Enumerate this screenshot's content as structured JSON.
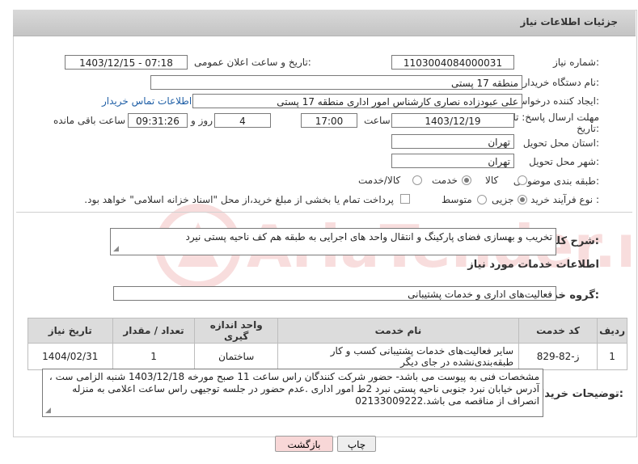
{
  "header": {
    "title": "جزئیات اطلاعات نیاز"
  },
  "fields": {
    "need_number_label": "شماره نیاز:",
    "need_number": "1103004084000031",
    "announce_label": "تاریخ و ساعت اعلان عمومی:",
    "announce_value": "1403/12/15 - 07:18",
    "buyer_label": "نام دستگاه خریدار:",
    "buyer_value": "منطقه 17 پستی",
    "creator_label": "ایجاد کننده درخواست:",
    "creator_value": "علی عبودزاده نصاری کارشناس امور اداری منطقه 17 پستی",
    "contact_link": "اطلاعات تماس خریدار",
    "deadline_label_1": "مهلت ارسال پاسخ: تا",
    "deadline_label_2": "تاریخ:",
    "deadline_date": "1403/12/19",
    "time_label": "ساعت",
    "deadline_time": "17:00",
    "days_value": "4",
    "days_label": "روز و",
    "remaining_time": "09:31:26",
    "remaining_label": "ساعت باقی مانده",
    "province_label": "استان محل تحویل:",
    "province_value": "تهران",
    "city_label": "شهر محل تحویل:",
    "city_value": "تهران",
    "category_label": "طبقه بندی موضوعی:",
    "category_options": [
      "کالا",
      "خدمت",
      "کالا/خدمت"
    ],
    "category_selected": "خدمت",
    "process_label": "نوع فرآیند خرید :",
    "process_options": [
      "جزیی",
      "متوسط"
    ],
    "process_selected": "جزیی",
    "payment_note": "پرداخت تمام یا بخشی از مبلغ خرید،از محل \"اسناد خزانه اسلامی\" خواهد بود."
  },
  "description": {
    "label": "شرح کلی نیاز:",
    "value": "تخریب و بهسازی فضای پارکینگ و انتقال واحد های اجرایی به طبقه هم کف ناحیه پستی نیرد"
  },
  "services": {
    "section_title": "اطلاعات خدمات مورد نیاز",
    "group_label": "گروه خدمت:",
    "group_value": "فعالیت‌های اداری و خدمات پشتیبانی",
    "columns": [
      "ردیف",
      "کد خدمت",
      "نام خدمت",
      "واحد اندازه گیری",
      "تعداد / مقدار",
      "تاریخ نیاز"
    ],
    "rows": [
      {
        "row": "1",
        "code": "ز-82-829",
        "name": "سایر فعالیت‌های خدمات پشتیبانی کسب و کار طبقه‌بندی‌نشده در جای دیگر",
        "unit": "ساختمان",
        "qty": "1",
        "date": "1404/02/31"
      }
    ]
  },
  "buyer_notes": {
    "label": "توضیحات خریدار:",
    "value": "مشخصات فنی به پیوست می باشد- حضور شرکت کنندگان راس ساعت 11 صبح مورخه 1403/12/18 شنبه الزامی ست ، آدرس خیابان نبرد جنوبی ناحیه پستی نبرد 2ط امور اداری  .عدم حضور در جلسه توجیهی راس ساعت اعلامی به منزله انصراف از مناقصه می باشد.02133009222"
  },
  "buttons": {
    "print": "چاپ",
    "back": "بازگشت"
  },
  "watermark": {
    "text": "AriaTender.net"
  },
  "colors": {
    "link": "#1f5fa6",
    "back_button_bg": "#f8d7d7",
    "print_button_bg": "#eeeeee"
  }
}
